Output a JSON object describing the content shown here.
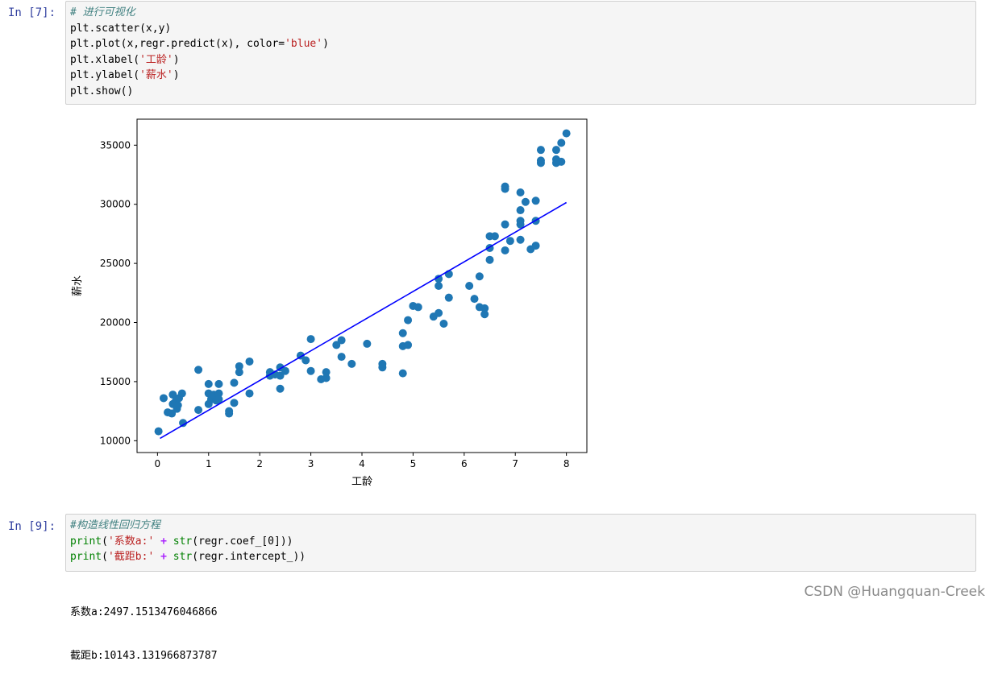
{
  "cells": [
    {
      "prompt": "In [7]:",
      "code": [
        [
          {
            "t": "comment",
            "s": "# 进行可视化"
          }
        ],
        [
          {
            "t": "name",
            "s": "plt.scatter(x,y)"
          }
        ],
        [
          {
            "t": "name",
            "s": "plt.plot(x,regr.predict(x), color="
          },
          {
            "t": "str",
            "s": "'blue'"
          },
          {
            "t": "name",
            "s": ")"
          }
        ],
        [
          {
            "t": "name",
            "s": "plt.xlabel("
          },
          {
            "t": "str",
            "s": "'工龄'"
          },
          {
            "t": "name",
            "s": ")"
          }
        ],
        [
          {
            "t": "name",
            "s": "plt.ylabel("
          },
          {
            "t": "str",
            "s": "'薪水'"
          },
          {
            "t": "name",
            "s": ")"
          }
        ],
        [
          {
            "t": "name",
            "s": "plt.show()"
          }
        ]
      ]
    },
    {
      "prompt": "In [9]:",
      "code": [
        [
          {
            "t": "comment",
            "s": "#构造线性回归方程"
          }
        ],
        [
          {
            "t": "builtin",
            "s": "print"
          },
          {
            "t": "name",
            "s": "("
          },
          {
            "t": "str",
            "s": "'系数a:'"
          },
          {
            "t": "name",
            "s": " "
          },
          {
            "t": "op",
            "s": "+"
          },
          {
            "t": "name",
            "s": " "
          },
          {
            "t": "builtin",
            "s": "str"
          },
          {
            "t": "name",
            "s": "(regr.coef_[0]))"
          }
        ],
        [
          {
            "t": "builtin",
            "s": "print"
          },
          {
            "t": "name",
            "s": "("
          },
          {
            "t": "str",
            "s": "'截距b:'"
          },
          {
            "t": "name",
            "s": " "
          },
          {
            "t": "op",
            "s": "+"
          },
          {
            "t": "name",
            "s": " "
          },
          {
            "t": "builtin",
            "s": "str"
          },
          {
            "t": "name",
            "s": "(regr.intercept_))"
          }
        ]
      ],
      "output": [
        "系数a:2497.1513476046866",
        "截距b:10143.131966873787"
      ]
    }
  ],
  "watermark": "CSDN @Huangquan-Creek",
  "chart_data": {
    "type": "scatter",
    "xlabel": "工龄",
    "ylabel": "薪水",
    "xlim": [
      -0.4,
      8.4
    ],
    "ylim": [
      9000,
      37200
    ],
    "xticks": [
      0,
      1,
      2,
      3,
      4,
      5,
      6,
      7,
      8
    ],
    "yticks": [
      10000,
      15000,
      20000,
      25000,
      30000,
      35000
    ],
    "point_color": "#1f77b4",
    "line_color": "#0000ff",
    "regression_line": {
      "x": [
        0.05,
        8.0
      ],
      "y": [
        10200,
        30150
      ]
    },
    "points": [
      [
        0.02,
        10800
      ],
      [
        0.12,
        13600
      ],
      [
        0.2,
        12400
      ],
      [
        0.28,
        12300
      ],
      [
        0.3,
        13900
      ],
      [
        0.3,
        13100
      ],
      [
        0.35,
        13300
      ],
      [
        0.38,
        12700
      ],
      [
        0.4,
        13000
      ],
      [
        0.42,
        13600
      ],
      [
        0.48,
        14000
      ],
      [
        0.5,
        11500
      ],
      [
        0.8,
        12600
      ],
      [
        0.8,
        16000
      ],
      [
        1.0,
        14000
      ],
      [
        1.0,
        14800
      ],
      [
        1.0,
        13100
      ],
      [
        1.05,
        13500
      ],
      [
        1.1,
        13900
      ],
      [
        1.15,
        13400
      ],
      [
        1.2,
        14000
      ],
      [
        1.2,
        14800
      ],
      [
        1.2,
        13500
      ],
      [
        1.4,
        12300
      ],
      [
        1.4,
        12500
      ],
      [
        1.5,
        13200
      ],
      [
        1.5,
        14900
      ],
      [
        1.6,
        16300
      ],
      [
        1.6,
        15800
      ],
      [
        1.8,
        16700
      ],
      [
        1.8,
        14000
      ],
      [
        2.2,
        15800
      ],
      [
        2.2,
        15500
      ],
      [
        2.3,
        15600
      ],
      [
        2.4,
        16200
      ],
      [
        2.4,
        15500
      ],
      [
        2.4,
        14400
      ],
      [
        2.5,
        15900
      ],
      [
        2.8,
        17200
      ],
      [
        2.9,
        16800
      ],
      [
        3.0,
        18600
      ],
      [
        3.0,
        15900
      ],
      [
        3.2,
        15200
      ],
      [
        3.3,
        15300
      ],
      [
        3.3,
        15800
      ],
      [
        3.5,
        18100
      ],
      [
        3.6,
        18500
      ],
      [
        3.6,
        17100
      ],
      [
        3.8,
        16500
      ],
      [
        4.1,
        18200
      ],
      [
        4.4,
        16200
      ],
      [
        4.4,
        16500
      ],
      [
        4.8,
        19100
      ],
      [
        4.8,
        18000
      ],
      [
        4.8,
        15700
      ],
      [
        4.9,
        18100
      ],
      [
        4.9,
        20200
      ],
      [
        5.0,
        21400
      ],
      [
        5.1,
        21300
      ],
      [
        5.4,
        20500
      ],
      [
        5.5,
        23700
      ],
      [
        5.5,
        23100
      ],
      [
        5.5,
        20800
      ],
      [
        5.6,
        19900
      ],
      [
        5.7,
        24100
      ],
      [
        5.7,
        22100
      ],
      [
        6.1,
        23100
      ],
      [
        6.2,
        22000
      ],
      [
        6.3,
        23900
      ],
      [
        6.3,
        21300
      ],
      [
        6.4,
        21200
      ],
      [
        6.4,
        20700
      ],
      [
        6.5,
        25300
      ],
      [
        6.5,
        26300
      ],
      [
        6.5,
        27300
      ],
      [
        6.6,
        27300
      ],
      [
        6.8,
        31500
      ],
      [
        6.8,
        31300
      ],
      [
        6.8,
        28300
      ],
      [
        6.8,
        26100
      ],
      [
        6.9,
        26900
      ],
      [
        7.1,
        31000
      ],
      [
        7.1,
        29500
      ],
      [
        7.1,
        28600
      ],
      [
        7.1,
        28300
      ],
      [
        7.1,
        27000
      ],
      [
        7.2,
        30200
      ],
      [
        7.3,
        26200
      ],
      [
        7.4,
        30300
      ],
      [
        7.4,
        28600
      ],
      [
        7.4,
        26500
      ],
      [
        7.5,
        34600
      ],
      [
        7.5,
        33700
      ],
      [
        7.5,
        33500
      ],
      [
        7.8,
        34600
      ],
      [
        7.8,
        33800
      ],
      [
        7.8,
        33500
      ],
      [
        7.9,
        35200
      ],
      [
        7.9,
        33600
      ],
      [
        8.0,
        36000
      ]
    ]
  }
}
